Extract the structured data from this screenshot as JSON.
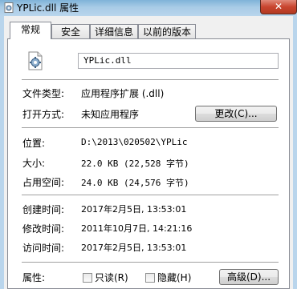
{
  "window": {
    "title": "YPLic.dll 属性",
    "close_glyph": "✕"
  },
  "tabs": [
    "常规",
    "安全",
    "详细信息",
    "以前的版本"
  ],
  "active_tab": "常规",
  "file": {
    "name": "YPLic.dll"
  },
  "type_row": {
    "label": "文件类型:",
    "value": "应用程序扩展 (.dll)"
  },
  "open_row": {
    "label": "打开方式:",
    "value": "未知应用程序",
    "button": "更改(C)..."
  },
  "location_row": {
    "label": "位置:",
    "value": "D:\\2013\\020502\\YPLic"
  },
  "size_row": {
    "label": "大小:",
    "value": "22.0 KB (22,528 字节)"
  },
  "disk_row": {
    "label": "占用空间:",
    "value": "24.0 KB (24,576 字节)"
  },
  "created_row": {
    "label": "创建时间:",
    "value": "2017年2月5日, 13:53:01"
  },
  "modified_row": {
    "label": "修改时间:",
    "value": "2011年10月7日, 14:21:16"
  },
  "accessed_row": {
    "label": "访问时间:",
    "value": "2017年2月5日, 13:53:01"
  },
  "attributes": {
    "label": "属性:",
    "readonly_label": "只读(R)",
    "readonly_checked": false,
    "hidden_label": "隐藏(H)",
    "hidden_checked": false,
    "advanced_button": "高级(D)..."
  },
  "colors": {
    "titlebar": "#a8cbe6",
    "close": "#c9452f",
    "panel": "#ffffff"
  },
  "icons": {
    "title": "dll-file-icon",
    "file": "gear-file-icon"
  }
}
